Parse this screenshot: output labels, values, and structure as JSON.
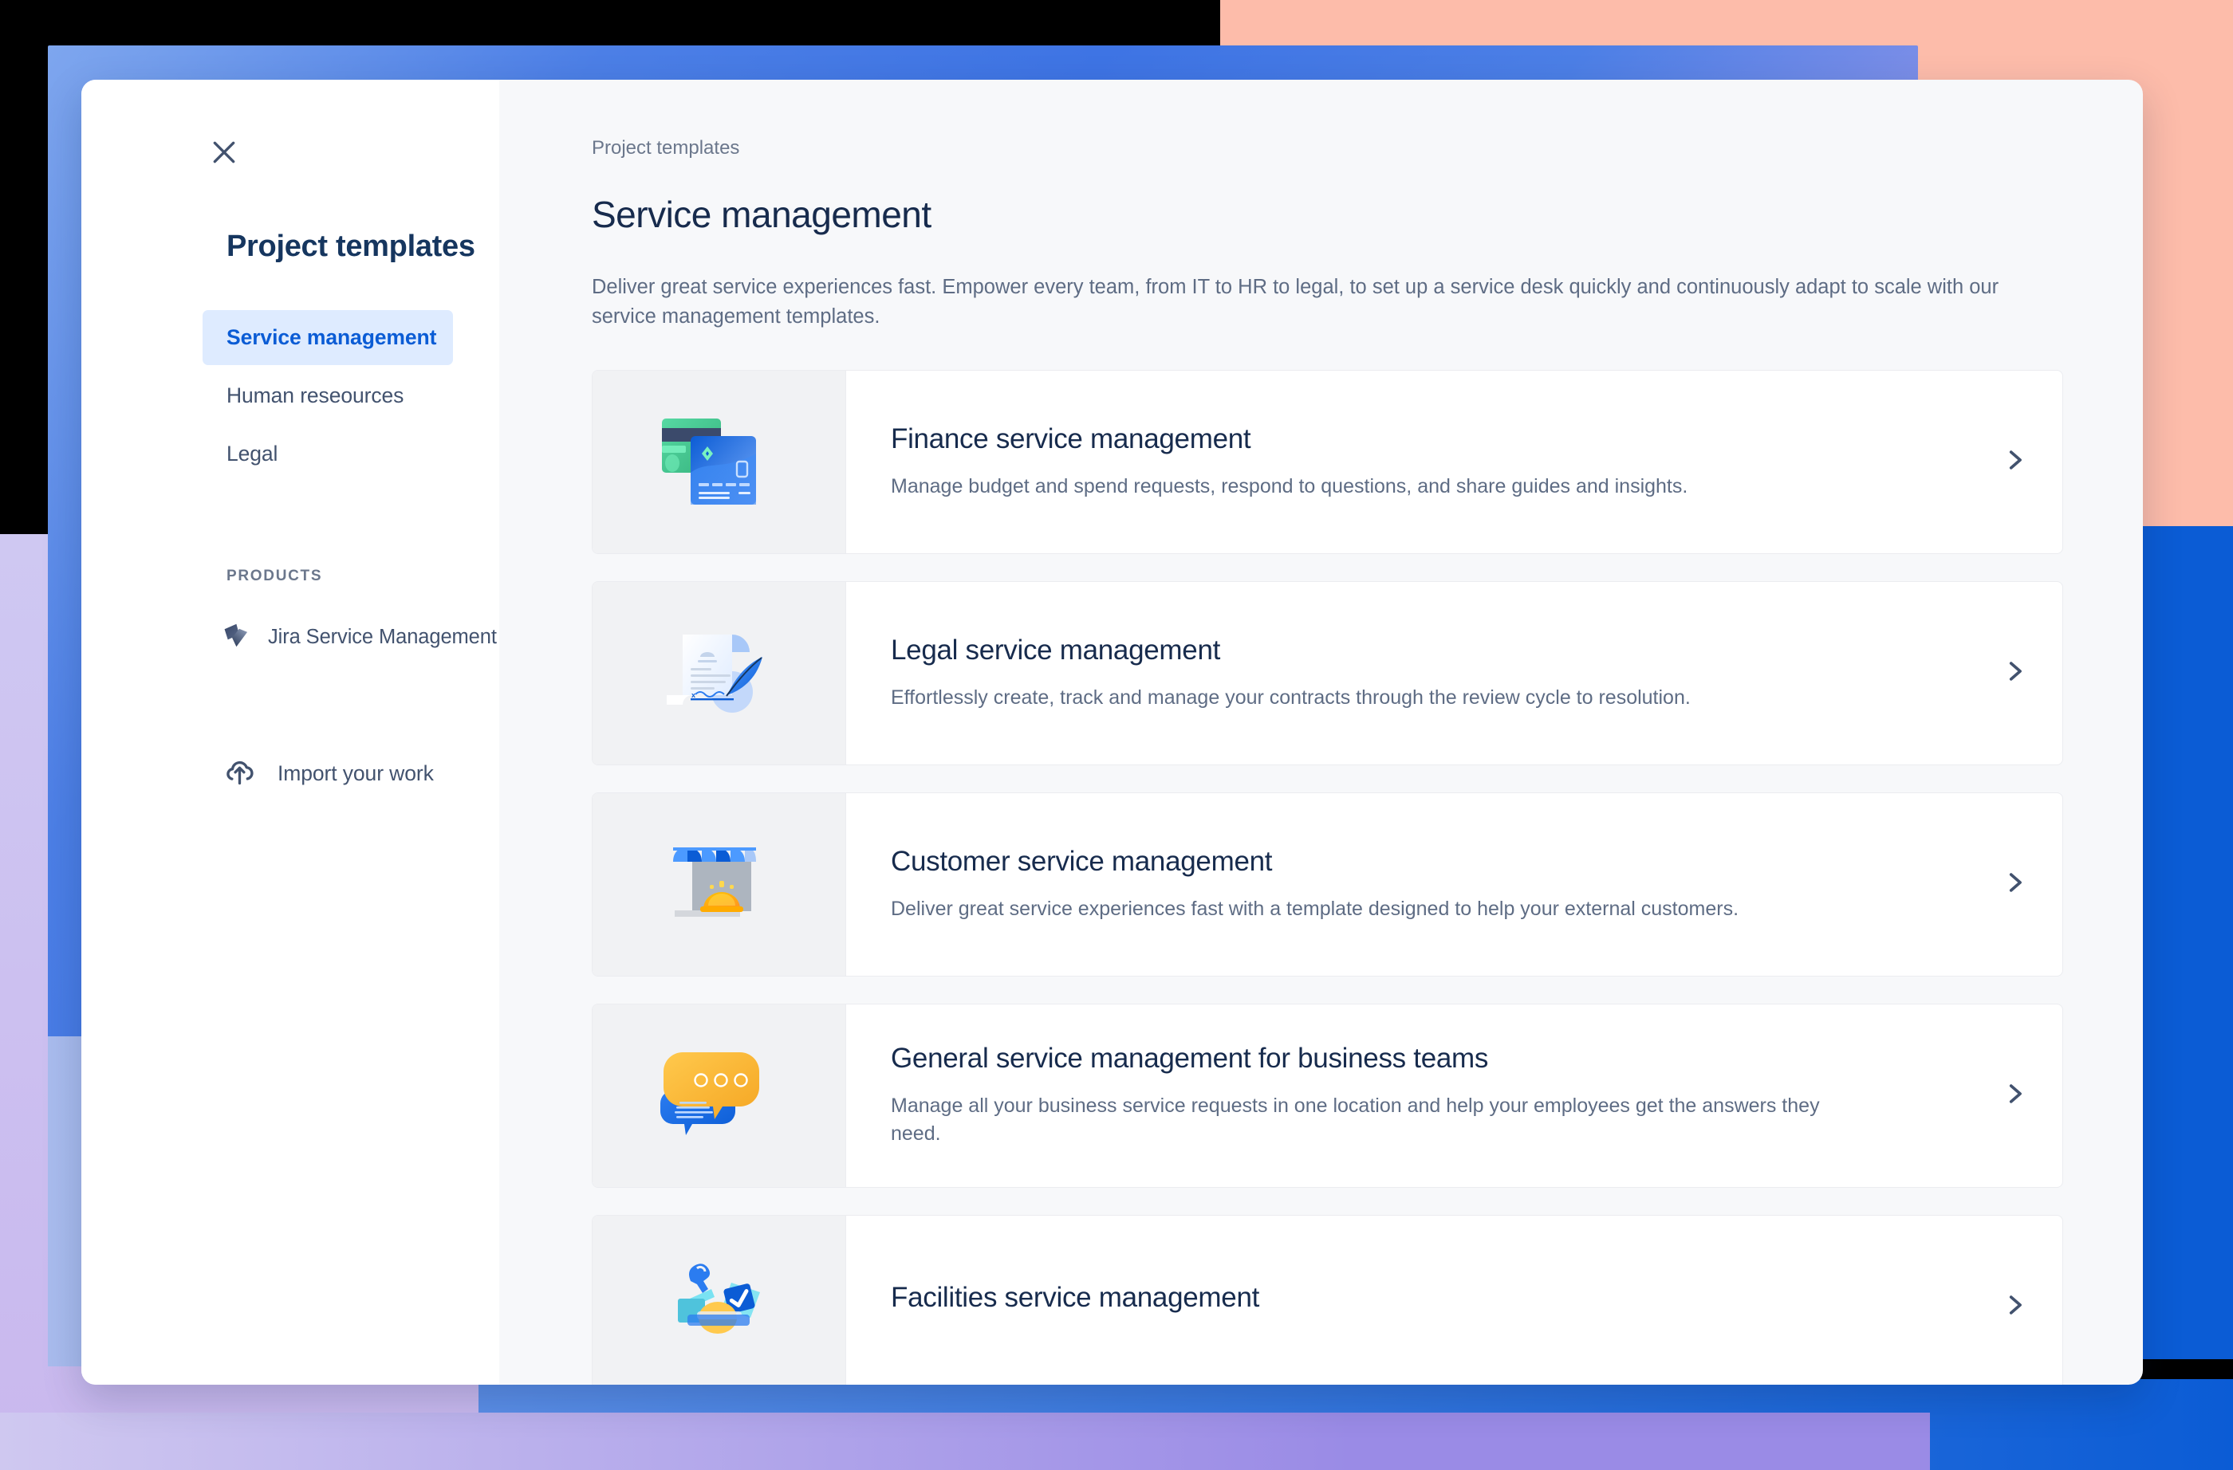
{
  "colors": {
    "accent_blue": "#0B5CD5",
    "nav_active_bg": "#DEEBFF",
    "text_dark": "#172B4D",
    "text_muted": "#5E6C84",
    "card_art_bg": "#F1F2F4",
    "modal_bg": "#F7F8FA",
    "bg_salmon": "#FDBCAA",
    "bg_lilac": "#CFC8F2"
  },
  "sidebar": {
    "close_icon": "close-icon",
    "title": "Project templates",
    "items": [
      {
        "label": "Service management",
        "active": true
      },
      {
        "label": "Human reseources",
        "active": false
      },
      {
        "label": "Legal",
        "active": false
      }
    ],
    "section_label": "PRODUCTS",
    "products": [
      {
        "label": "Jira Service Management",
        "icon": "jira-service-management-icon"
      }
    ],
    "import": {
      "label": "Import your work",
      "icon": "cloud-upload-icon"
    }
  },
  "main": {
    "breadcrumb": "Project templates",
    "title": "Service management",
    "description": "Deliver great service experiences fast. Empower every team, from IT to HR to legal, to set up a service desk quickly and continuously adapt to scale with our service management templates.",
    "chevron_icon": "chevron-right-icon",
    "templates": [
      {
        "title": "Finance service management",
        "description": "Manage budget and spend requests, respond to questions, and share guides and insights.",
        "art": "credit-cards-illustration"
      },
      {
        "title": "Legal service management",
        "description": "Effortlessly create, track and manage your contracts through the review cycle to resolution.",
        "art": "contract-quill-illustration"
      },
      {
        "title": "Customer service management",
        "description": "Deliver great service experiences fast with a template designed to help your external customers.",
        "art": "storefront-bell-illustration"
      },
      {
        "title": "General service management for business teams",
        "description": "Manage all your business service requests in one location and help your employees get the answers they need.",
        "art": "chat-bubbles-illustration"
      },
      {
        "title": "Facilities service management",
        "description": "",
        "art": "toolbox-illustration"
      }
    ]
  }
}
